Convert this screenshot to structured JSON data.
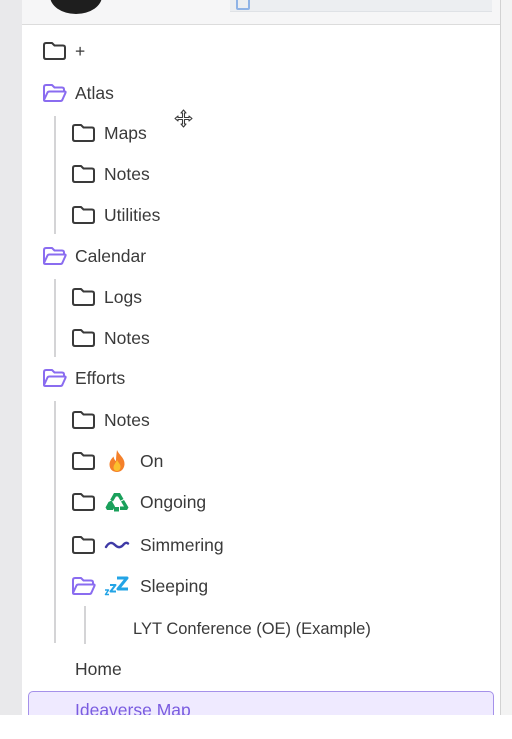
{
  "tree": {
    "items": [
      {
        "label": "+",
        "icon": "folder-closed-icon"
      },
      {
        "label": "Atlas",
        "icon": "folder-open-icon"
      },
      {
        "label": "Maps",
        "icon": "folder-closed-icon"
      },
      {
        "label": "Notes",
        "icon": "folder-closed-icon"
      },
      {
        "label": "Utilities",
        "icon": "folder-closed-icon"
      },
      {
        "label": "Calendar",
        "icon": "folder-open-icon"
      },
      {
        "label": "Logs",
        "icon": "folder-closed-icon"
      },
      {
        "label": "Notes",
        "icon": "folder-closed-icon"
      },
      {
        "label": "Efforts",
        "icon": "folder-open-icon"
      },
      {
        "label": "Notes",
        "icon": "folder-closed-icon"
      },
      {
        "label": "On",
        "icon": "folder-closed-icon",
        "emoji": "fire-icon"
      },
      {
        "label": "Ongoing",
        "icon": "folder-closed-icon",
        "emoji": "recycle-icon"
      },
      {
        "label": "Simmering",
        "icon": "folder-closed-icon",
        "emoji": "wavy-dash-icon"
      },
      {
        "label": "Sleeping",
        "icon": "folder-open-icon",
        "emoji": "zzz-icon"
      },
      {
        "label": "LYT Conference (OE) (Example)"
      },
      {
        "label": "Home"
      },
      {
        "label": "Ideaverse Map",
        "selected": true
      }
    ]
  },
  "colors": {
    "accent": "#7a5ce0",
    "folder_open": "#8a6cf0",
    "folder_closed": "#3a3a3a",
    "selected_bg": "#efeaff",
    "selected_border": "#a591ea"
  }
}
